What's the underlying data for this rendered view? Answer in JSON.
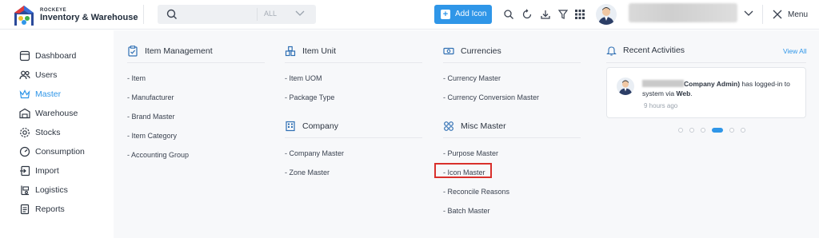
{
  "app": {
    "brand_small": "ROCKEYE",
    "brand_title": "Inventory & Warehouse"
  },
  "search": {
    "placeholder": "",
    "value": "",
    "scope": "ALL"
  },
  "header": {
    "add_icon_label": "Add Icon",
    "menu_label": "Menu",
    "icons": [
      "search-icon",
      "refresh-icon",
      "download-icon",
      "filter-icon",
      "apps-grid-icon"
    ]
  },
  "sidebar": {
    "items": [
      {
        "label": "Dashboard",
        "icon": "dashboard-icon",
        "active": false
      },
      {
        "label": "Users",
        "icon": "users-icon",
        "active": false
      },
      {
        "label": "Master",
        "icon": "crown-icon",
        "active": true
      },
      {
        "label": "Warehouse",
        "icon": "warehouse-icon",
        "active": false
      },
      {
        "label": "Stocks",
        "icon": "stocks-icon",
        "active": false
      },
      {
        "label": "Consumption",
        "icon": "gauge-icon",
        "active": false
      },
      {
        "label": "Import",
        "icon": "import-icon",
        "active": false
      },
      {
        "label": "Logistics",
        "icon": "logistics-icon",
        "active": false
      },
      {
        "label": "Reports",
        "icon": "reports-icon",
        "active": false
      }
    ]
  },
  "menu": {
    "item_management": {
      "title": "Item Management",
      "links": [
        "- Item",
        "- Manufacturer",
        "- Brand Master",
        "- Item Category",
        "- Accounting Group"
      ]
    },
    "item_unit": {
      "title": "Item Unit",
      "links": [
        "- Item UOM",
        "- Package Type"
      ]
    },
    "company": {
      "title": "Company",
      "links": [
        "- Company Master",
        "- Zone Master"
      ]
    },
    "currencies": {
      "title": "Currencies",
      "links": [
        "- Currency Master",
        "- Currency Conversion Master"
      ]
    },
    "misc_master": {
      "title": "Misc Master",
      "links": [
        "- Purpose Master",
        "- Icon Master",
        "- Reconcile Reasons",
        "- Batch Master"
      ]
    }
  },
  "activities": {
    "title": "Recent Activities",
    "view_all": "View All",
    "item": {
      "role": "Company Admin)",
      "text_mid": " has logged-in to system via ",
      "channel": "Web",
      "end": ".",
      "time": "9 hours ago"
    },
    "pager": {
      "count": 6,
      "active_index": 3
    }
  },
  "colors": {
    "accent": "#2f96e8",
    "highlight": "#d9302c"
  }
}
